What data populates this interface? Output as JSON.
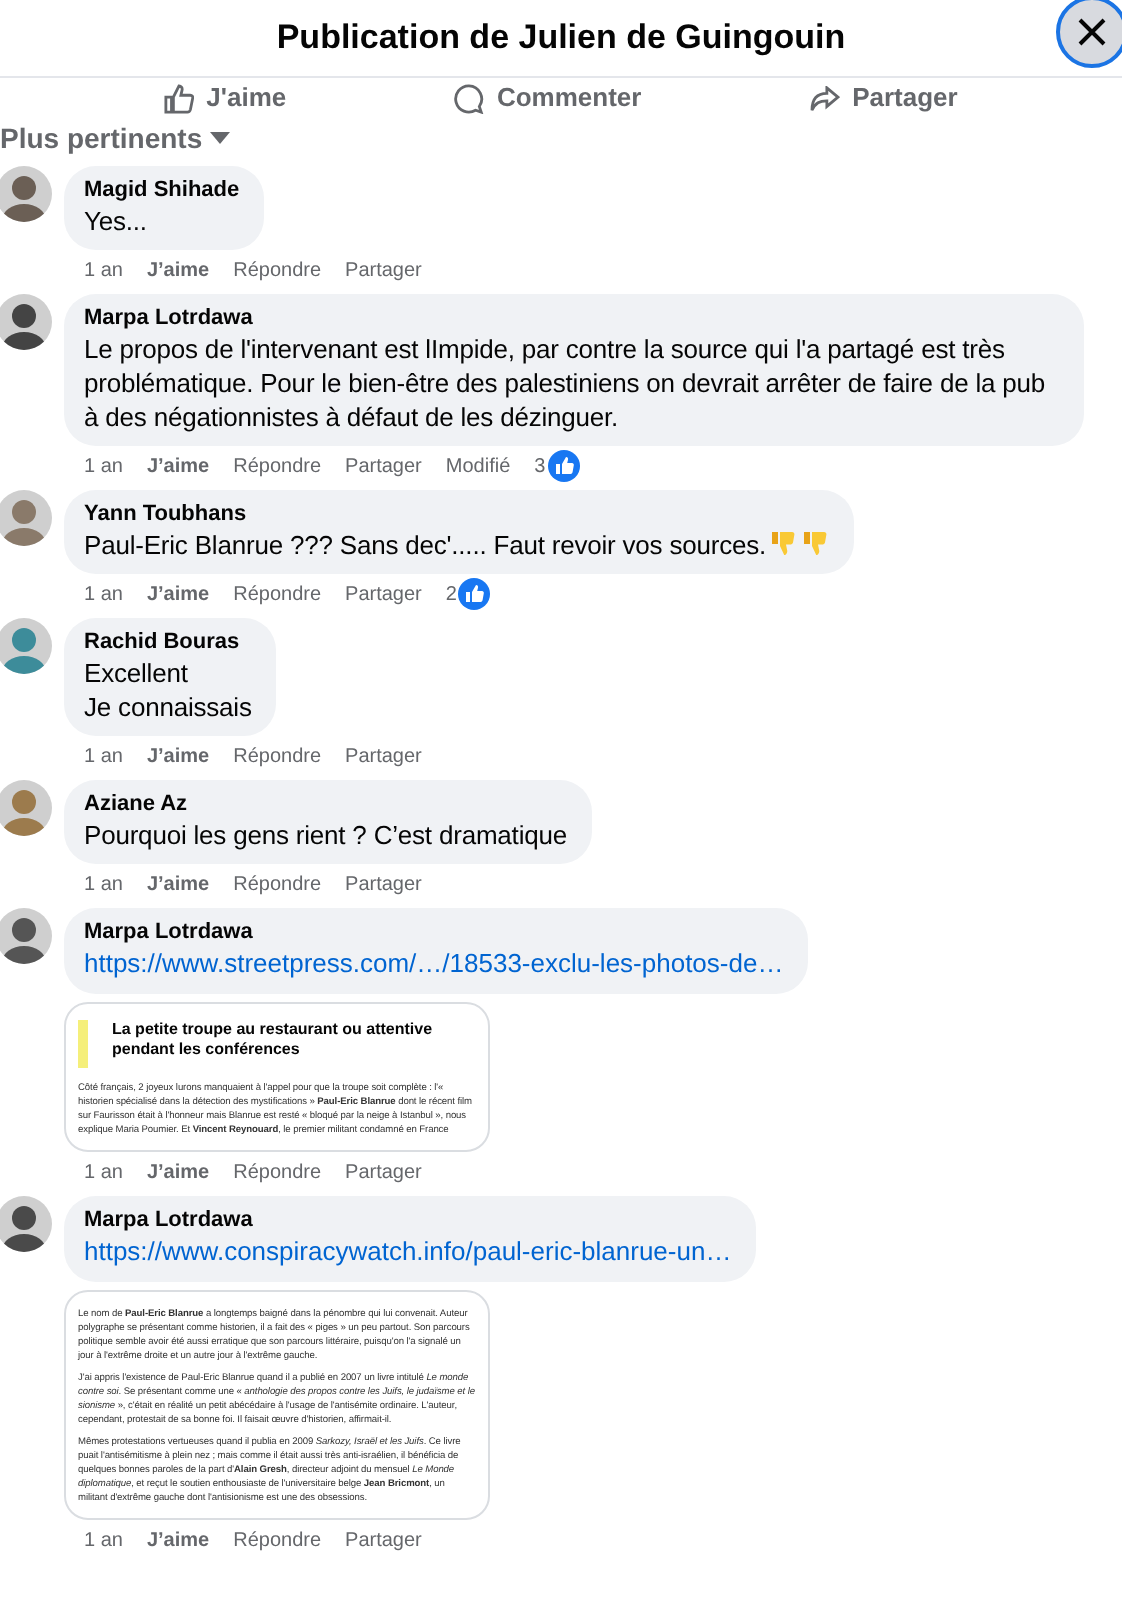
{
  "header": {
    "title": "Publication de Julien de Guingouin"
  },
  "post_actions": [
    "J'aime",
    "Commenter",
    "Partager"
  ],
  "sort": {
    "label": "Plus pertinents"
  },
  "comments": [
    {
      "author": "Magid Shihade",
      "lines": [
        "Yes..."
      ],
      "time": "1 an",
      "like": "J’aime",
      "reply": "Répondre",
      "share": "Partager"
    },
    {
      "author": "Marpa Lotrdawa",
      "lines": [
        "Le propos de l'intervenant est lImpide, par contre la source qui l'a partagé est très problématique. Pour le bien-être des palestiniens on devrait arrêter de faire de la pub à des négationnistes à défaut de les dézinguer."
      ],
      "time": "1 an",
      "like": "J’aime",
      "reply": "Répondre",
      "share": "Partager",
      "edited": "Modifié",
      "reactions": "3"
    },
    {
      "author": "Yann Toubhans",
      "lines": [
        "Paul-Eric Blanrue ??? Sans dec'..... Faut revoir vos sources."
      ],
      "emojis": [
        {
          "kind": "thumbs_down"
        },
        {
          "kind": "thumbs_down"
        }
      ],
      "time": "1 an",
      "like": "J’aime",
      "reply": "Répondre",
      "share": "Partager",
      "reactions": "2"
    },
    {
      "author": "Rachid Bouras",
      "lines": [
        "Excellent",
        "Je connaissais"
      ],
      "time": "1 an",
      "like": "J’aime",
      "reply": "Répondre",
      "share": "Partager"
    },
    {
      "author": "Aziane Az",
      "lines": [
        "Pourquoi les gens rient ? C’est dramatique"
      ],
      "time": "1 an",
      "like": "J’aime",
      "reply": "Répondre",
      "share": "Partager"
    },
    {
      "author": "Marpa Lotrdawa",
      "link": "https://www.streetpress.com/…/18533-exclu-les-photos-de…",
      "attachment": {
        "heading": "La petite troupe au restaurant ou attentive pendant les conférences",
        "paragraphs": [
          "Côté français, 2 joyeux lurons manquaient à l'appel pour que la troupe soit complète : l'« historien spécialisé dans la détection des mystifications » **Paul-Eric Blanrue** dont le récent film sur Faurisson était à l'honneur mais Blanrue est resté « bloqué par la neige à Istanbul », nous explique Maria Poumier. Et **Vincent Reynouard**, le premier militant condamné en France"
        ]
      },
      "time": "1 an",
      "like": "J’aime",
      "reply": "Répondre",
      "share": "Partager"
    },
    {
      "author": "Marpa Lotrdawa",
      "link": "https://www.conspiracywatch.info/paul-eric-blanrue-un…",
      "attachment": {
        "paragraphs": [
          "Le nom de **Paul-Eric Blanrue** a longtemps baigné dans la pénombre qui lui convenait. Auteur polygraphe se présentant comme historien, il a fait des « piges » un peu partout. Son parcours politique semble avoir été aussi erratique que son parcours littéraire, puisqu'on l'a signalé un jour à l'extrême droite et un autre jour à l'extrême gauche.",
          "J'ai appris l'existence de Paul-Eric Blanrue quand il a publié en 2007 un livre intitulé *Le monde contre soi*. Se présentant comme une « *anthologie des propos contre les Juifs, le judaïsme et le sionisme* », c'était en réalité un petit abécédaire à l'usage de l'antisémite ordinaire. L'auteur, cependant, protestait de sa bonne foi. Il faisait œuvre d'historien, affirmait-il.",
          "Mêmes protestations vertueuses quand il publia en 2009 *Sarkozy, Israël et les Juifs*. Ce livre puait l'antisémitisme à plein nez ; mais comme il était aussi très anti-israélien, il bénéficia de quelques bonnes paroles de la part d'**Alain Gresh**, directeur adjoint du mensuel *Le Monde diplomatique*, et reçut le soutien enthousiaste de l'universitaire belge **Jean Bricmont**, un militant d'extrême gauche dont l'antisionisme est une des obsessions."
        ]
      },
      "time": "1 an",
      "like": "J’aime",
      "reply": "Répondre",
      "share": "Partager"
    }
  ]
}
